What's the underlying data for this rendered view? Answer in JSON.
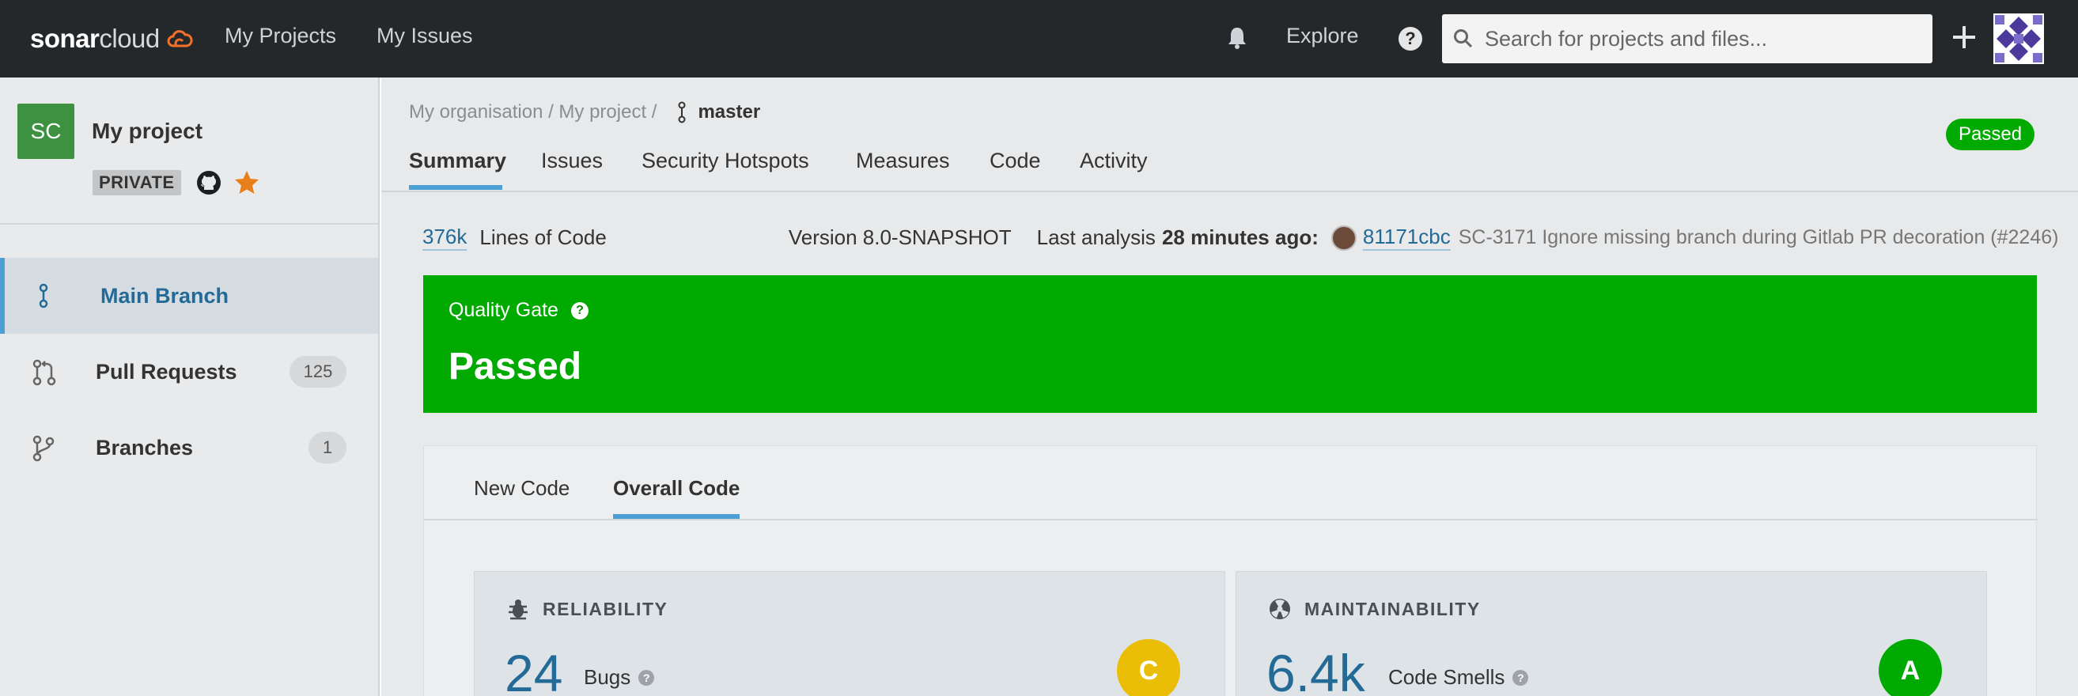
{
  "topbar": {
    "logo_bold": "sonar",
    "logo_light": "cloud",
    "nav": [
      "My Projects",
      "My Issues"
    ],
    "explore": "Explore",
    "help": "?",
    "search_placeholder": "Search for projects and files...",
    "icons": [
      "bell-icon",
      "help-icon",
      "search-icon",
      "plus-icon",
      "user-avatar"
    ]
  },
  "sidebar": {
    "project_initials": "SC",
    "project_name": "My project",
    "visibility": "PRIVATE",
    "items": [
      {
        "label": "Main Branch",
        "icon": "branch-icon",
        "active": true
      },
      {
        "label": "Pull Requests",
        "icon": "pull-request-icon",
        "count": "125"
      },
      {
        "label": "Branches",
        "icon": "fork-icon",
        "count": "1"
      }
    ]
  },
  "header": {
    "breadcrumb": "My organisation / My project /",
    "branch": "master",
    "tabs": [
      "Summary",
      "Issues",
      "Security Hotspots",
      "Measures",
      "Code",
      "Activity"
    ],
    "status_badge": "Passed"
  },
  "info": {
    "loc_value": "376k",
    "loc_label": "Lines of Code",
    "version": "Version 8.0-SNAPSHOT",
    "last_analysis_prefix": "Last analysis",
    "last_analysis_time": "28 minutes ago:",
    "commit_hash": "81171cbc",
    "commit_message": "SC-3171 Ignore missing branch during Gitlab PR decoration (#2246)"
  },
  "quality_gate": {
    "title": "Quality Gate",
    "help": "?",
    "status": "Passed",
    "color": "#00aa00"
  },
  "panel": {
    "tabs": [
      "New Code",
      "Overall Code"
    ],
    "active_tab": "Overall Code",
    "cards": [
      {
        "heading": "RELIABILITY",
        "value": "24",
        "label": "Bugs",
        "rating": "C",
        "rating_color": "#eabe06"
      },
      {
        "heading": "MAINTAINABILITY",
        "value": "6.4k",
        "label": "Code Smells",
        "rating": "A",
        "rating_color": "#00aa00"
      }
    ]
  },
  "colors": {
    "topbar": "#25282b",
    "accent": "#4b9fd5",
    "link": "#236a97",
    "passed": "#00aa00"
  }
}
